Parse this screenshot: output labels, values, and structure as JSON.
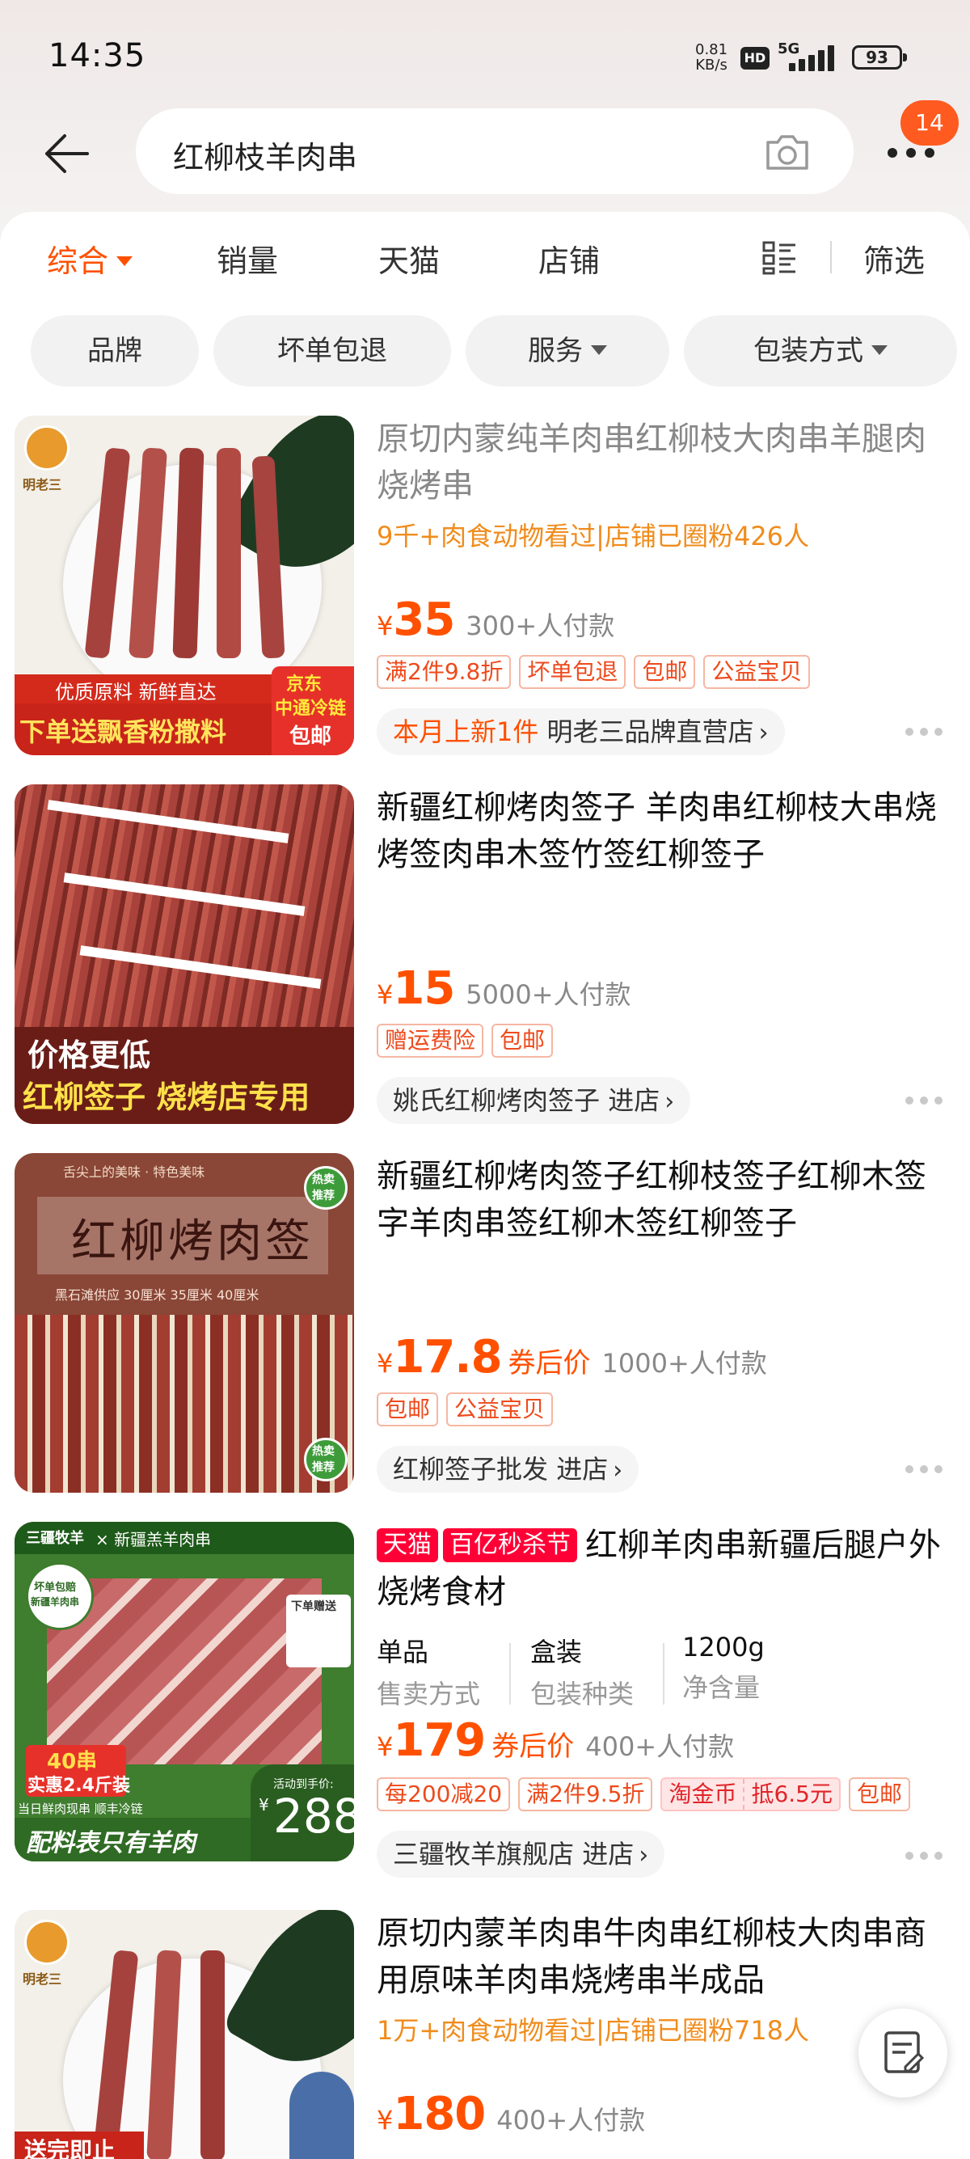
{
  "status_bar": {
    "time": "14:35",
    "net_speed": "0.81",
    "net_unit": "KB/s",
    "hd": "HD",
    "network": "5G",
    "battery": "93"
  },
  "search": {
    "query": "红柳枝羊肉串",
    "badge_count": "14"
  },
  "sort_tabs": [
    {
      "label": "综合",
      "active": true
    },
    {
      "label": "销量"
    },
    {
      "label": "天猫"
    },
    {
      "label": "店铺"
    }
  ],
  "filter_label": "筛选",
  "filter_chips": [
    {
      "label": "品牌"
    },
    {
      "label": "坏单包退"
    },
    {
      "label": "服务"
    },
    {
      "label": "包装方式"
    }
  ],
  "products": [
    {
      "title": "原切内蒙纯羊肉串红柳枝大肉串羊腿肉烧烤串",
      "hot": "9千+肉食动物看过|店铺已圈粉426人",
      "currency": "¥",
      "price": "35",
      "paid": "300+人付款",
      "tags": [
        "满2件9.8折",
        "坏单包退",
        "包邮",
        "公益宝贝"
      ],
      "store_new": "本月上新1件",
      "store": "明老三品牌直营店",
      "thumb": {
        "brand": "明老三",
        "line1": "优质原料 新鲜直达",
        "line2": "下单送飘香粉撒料",
        "side1": "京东",
        "side2": "中通冷链",
        "side3": "包邮"
      }
    },
    {
      "title": "新疆红柳烤肉签子  羊肉串红柳枝大串烧烤签肉串木签竹签红柳签子",
      "currency": "¥",
      "price": "15",
      "paid": "5000+人付款",
      "tags": [
        "赠运费险",
        "包邮"
      ],
      "store": "姚氏红柳烤肉签子",
      "enter": "进店",
      "thumb": {
        "line1": "价格更低",
        "line2": "红柳签子 烧烤店专用"
      }
    },
    {
      "title": "新疆红柳烤肉签子红柳枝签子红柳木签字羊肉串签红柳木签红柳签子",
      "currency": "¥",
      "price": "17.8",
      "coupon": "券后价",
      "paid": "1000+人付款",
      "tags": [
        "包邮",
        "公益宝贝"
      ],
      "store": "红柳签子批发",
      "enter": "进店",
      "thumb": {
        "banner": "红柳烤肉签",
        "sub": "舌尖上的美味 · 特色美味",
        "sizes": "黑石滩供应  30厘米  35厘米  40厘米",
        "hot1": "热卖",
        "hot2": "推荐"
      }
    },
    {
      "label_tmall": "天猫",
      "label_flash": "百亿秒杀节",
      "title": "红柳羊肉串新疆后腿户外烧烤食材",
      "attrs": [
        {
          "value": "单品",
          "key": "售卖方式"
        },
        {
          "value": "盒装",
          "key": "包装种类"
        },
        {
          "value": "1200g",
          "key": "净含量"
        }
      ],
      "currency": "¥",
      "price": "179",
      "coupon": "券后价",
      "paid": "400+人付款",
      "tags": [
        "每200减20",
        "满2件9.5折",
        "包邮"
      ],
      "coin_tag": [
        "淘金币",
        "抵6.5元"
      ],
      "store": "三疆牧羊旗舰店",
      "enter": "进店",
      "thumb": {
        "top": "× 新疆羔羊肉串",
        "brand": "三疆牧羊",
        "round1": "坏单包赔",
        "round2": "新疆羊肉串",
        "gift": "下单赠送",
        "count": "40串",
        "weight": "实惠2.4斤装",
        "ship": "当日鲜肉现串 顺丰冷链",
        "bottom": "配料表只有羊肉",
        "act": "活动到手价:",
        "actprice": "288"
      }
    },
    {
      "title": "原切内蒙羊肉串牛肉串红柳枝大肉串商用原味羊肉串烧烤串半成品",
      "hot": "1万+肉食动物看过|店铺已圈粉718人",
      "currency": "¥",
      "price": "180",
      "paid": "400+人付款",
      "thumb": {
        "brand": "明老三",
        "bottom": "送完即止"
      }
    }
  ],
  "colors": {
    "accent": "#ff5000",
    "tmall": "#ff0036",
    "hot": "#f08c1c"
  }
}
